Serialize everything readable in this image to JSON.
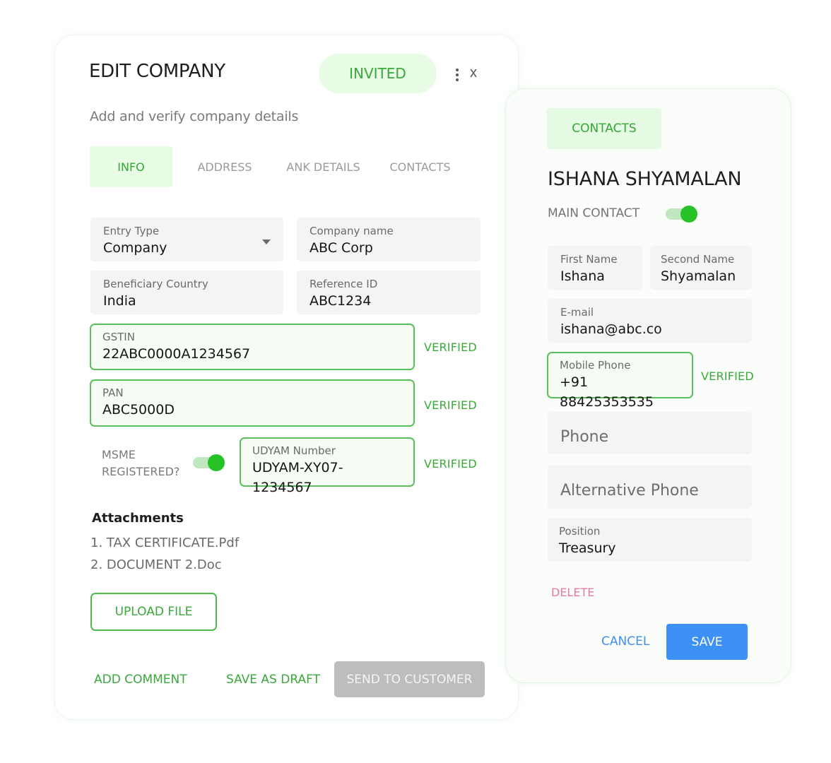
{
  "edit_company": {
    "title": "EDIT COMPANY",
    "subtitle": "Add and verify company details",
    "status_badge": "INVITED",
    "more_icon": "kebab-vertical-icon",
    "close_icon": "x",
    "tabs": [
      {
        "label": "INFO",
        "active": true
      },
      {
        "label": "ADDRESS",
        "active": false
      },
      {
        "label": "ANK DETAILS",
        "active": false
      },
      {
        "label": "CONTACTS",
        "active": false
      }
    ],
    "fields": {
      "entry_type": {
        "label": "Entry Type",
        "value": "Company"
      },
      "company_name": {
        "label": "Company name",
        "value": "ABC Corp"
      },
      "beneficiary_country": {
        "label": "Beneficiary Country",
        "value": "India"
      },
      "reference_id": {
        "label": "Reference ID",
        "value": "ABC1234"
      },
      "gstin": {
        "label": "GSTIN",
        "value": "22ABC0000A1234567",
        "status": "VERIFIED"
      },
      "pan": {
        "label": "PAN",
        "value": "ABC5000D",
        "status": "VERIFIED"
      },
      "udyam": {
        "label": "UDYAM Number",
        "value": "UDYAM-XY07-1234567",
        "status": "VERIFIED"
      }
    },
    "msme": {
      "label_line1": "MSME",
      "label_line2": "REGISTERED?",
      "enabled": true
    },
    "attachments": {
      "heading": "Attachments",
      "items": [
        "1. TAX CERTIFICATE.Pdf",
        "2. DOCUMENT 2.Doc"
      ],
      "upload_label": "UPLOAD FILE"
    },
    "footer": {
      "add_comment": "ADD COMMENT",
      "save_draft": "SAVE AS DRAFT",
      "send_customer": "SEND TO CUSTOMER"
    }
  },
  "contact_panel": {
    "tab_label": "CONTACTS",
    "name": "ISHANA SHYAMALAN",
    "main_contact_label": "MAIN CONTACT",
    "main_contact_enabled": true,
    "fields": {
      "first_name": {
        "label": "First Name",
        "value": "Ishana"
      },
      "second_name": {
        "label": "Second Name",
        "value": "Shyamalan"
      },
      "email": {
        "label": "E-mail",
        "value": "ishana@abc.co"
      },
      "mobile": {
        "label": "Mobile Phone",
        "value": "+91 88425353535",
        "status": "VERIFIED"
      },
      "phone": {
        "placeholder": "Phone"
      },
      "alt_phone": {
        "placeholder": "Alternative Phone"
      },
      "position": {
        "label": "Position",
        "value": "Treasury"
      }
    },
    "delete_label": "DELETE",
    "cancel_label": "CANCEL",
    "save_label": "SAVE"
  },
  "colors": {
    "accent_green": "#3aa83a",
    "badge_bg": "#e7fbe5",
    "save_blue": "#3d91f5",
    "delete_pink": "#e67aa0",
    "disabled_gray": "#bdbdbd"
  }
}
